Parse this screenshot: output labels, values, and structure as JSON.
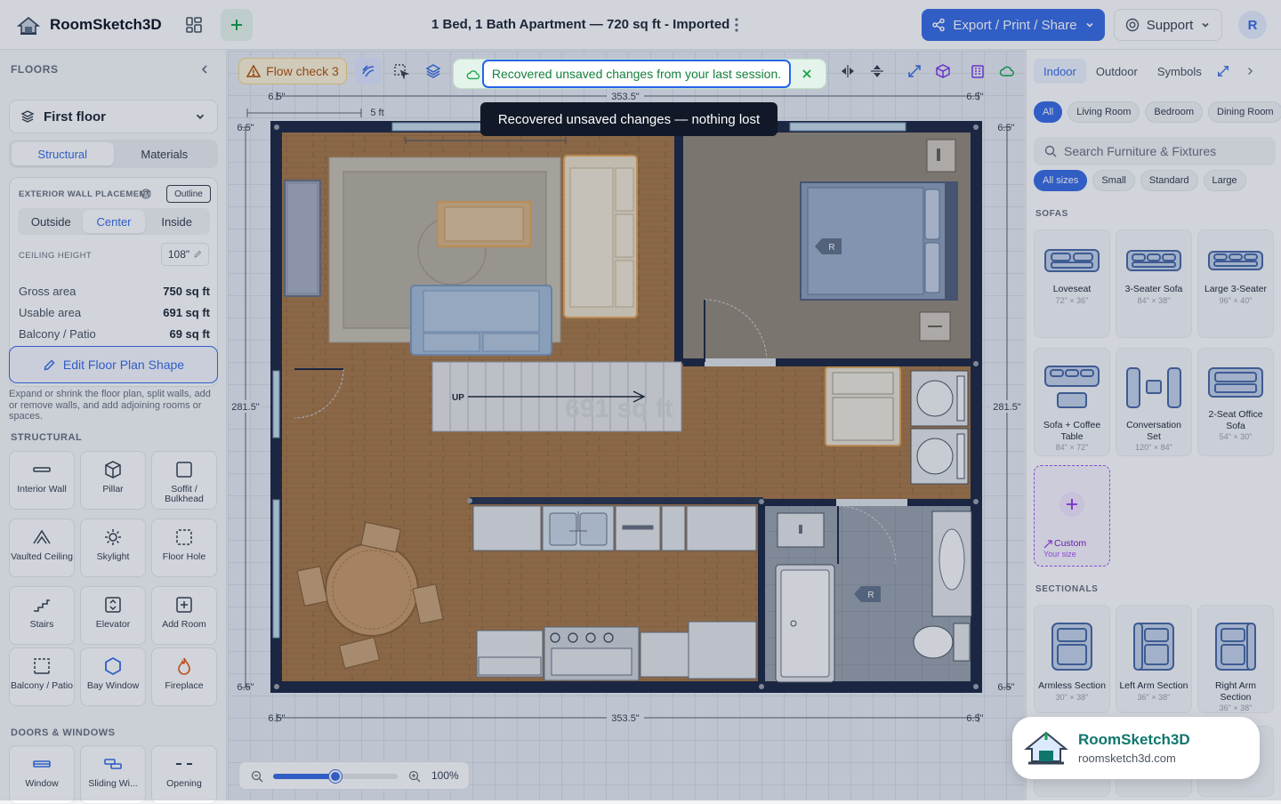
{
  "app": {
    "name": "RoomSketch3D"
  },
  "document": {
    "title": "1 Bed, 1 Bath Apartment — 720 sq ft - Imported"
  },
  "topbar": {
    "export_label": "Export / Print / Share",
    "support_label": "Support",
    "avatar_initial": "R"
  },
  "left": {
    "floors_header": "FLOORS",
    "floor_selected": "First floor",
    "tabs": [
      {
        "label": "Structural",
        "active": true
      },
      {
        "label": "Materials",
        "active": false
      }
    ],
    "wall_placement_label": "EXTERIOR WALL PLACEMENT",
    "outline_label": "Outline",
    "wall_options": [
      {
        "label": "Outside",
        "active": false
      },
      {
        "label": "Center",
        "active": true
      },
      {
        "label": "Inside",
        "active": false
      }
    ],
    "ceiling_label": "CEILING HEIGHT",
    "ceiling_value": "108\"",
    "stats": [
      {
        "label": "Gross area",
        "value": "750 sq ft"
      },
      {
        "label": "Usable area",
        "value": "691 sq ft"
      },
      {
        "label": "Balcony / Patio",
        "value": "69 sq ft"
      }
    ],
    "edit_shape_label": "Edit Floor Plan Shape",
    "edit_shape_desc": "Expand or shrink the floor plan, split walls, add or remove walls, and add adjoining rooms or spaces.",
    "structural_header": "STRUCTURAL",
    "tools": [
      {
        "label": "Interior Wall",
        "icon": "interior-wall-icon"
      },
      {
        "label": "Pillar",
        "icon": "pillar-icon"
      },
      {
        "label": "Soffit / Bulkhead",
        "icon": "soffit-icon"
      },
      {
        "label": "Vaulted Ceiling",
        "icon": "vaulted-ceiling-icon"
      },
      {
        "label": "Skylight",
        "icon": "skylight-icon"
      },
      {
        "label": "Floor Hole",
        "icon": "floor-hole-icon"
      },
      {
        "label": "Stairs",
        "icon": "stairs-icon"
      },
      {
        "label": "Elevator",
        "icon": "elevator-icon"
      },
      {
        "label": "Add Room",
        "icon": "add-room-icon"
      },
      {
        "label": "Balcony / Patio",
        "icon": "balcony-icon"
      },
      {
        "label": "Bay Window",
        "icon": "bay-window-icon"
      },
      {
        "label": "Fireplace",
        "icon": "fireplace-icon"
      }
    ],
    "doors_header": "DOORS & WINDOWS",
    "door_tools": [
      {
        "label": "Window",
        "icon": "window-icon"
      },
      {
        "label": "Sliding Wi...",
        "icon": "sliding-window-icon"
      },
      {
        "label": "Opening",
        "icon": "opening-icon"
      }
    ]
  },
  "canvas": {
    "flow_check_label": "Flow check 3",
    "scale_label": "5 ft",
    "dims": {
      "top": "353.5\"",
      "bottom": "353.5\"",
      "left": "281.5\"",
      "right": "281.5\"",
      "margin": "6.5\""
    },
    "stairs_label": "UP",
    "area_watermark": "691 sq ft",
    "room_tag": "R",
    "zoom": {
      "value_label": "100%",
      "level": 0.5
    }
  },
  "right": {
    "tabs": [
      {
        "label": "Indoor",
        "active": true
      },
      {
        "label": "Outdoor",
        "active": false
      },
      {
        "label": "Symbols",
        "active": false
      }
    ],
    "room_filters": [
      {
        "label": "All",
        "active": true
      },
      {
        "label": "Living Room",
        "active": false
      },
      {
        "label": "Bedroom",
        "active": false
      },
      {
        "label": "Dining Room",
        "active": false
      }
    ],
    "search_placeholder": "Search Furniture & Fixtures",
    "size_filters": [
      {
        "label": "All sizes",
        "active": true
      },
      {
        "label": "Small",
        "active": false
      },
      {
        "label": "Standard",
        "active": false
      },
      {
        "label": "Large",
        "active": false
      }
    ],
    "sofas_header": "SOFAS",
    "sofas": [
      {
        "name": "Loveseat",
        "dims": "72\" × 36\""
      },
      {
        "name": "3-Seater Sofa",
        "dims": "84\" × 38\""
      },
      {
        "name": "Large 3-Seater",
        "dims": "96\" × 40\""
      },
      {
        "name": "Sofa + Coffee Table",
        "dims": "84\" × 72\""
      },
      {
        "name": "Conversation Set",
        "dims": "120\" × 84\""
      },
      {
        "name": "2-Seat Office Sofa",
        "dims": "54\" × 30\""
      }
    ],
    "custom": {
      "label": "Custom",
      "sub": "Your size"
    },
    "sectionals_header": "SECTIONALS",
    "sectionals": [
      {
        "name": "Armless Section",
        "dims": "30\" × 38\""
      },
      {
        "name": "Left Arm Section",
        "dims": "36\" × 38\""
      },
      {
        "name": "Right Arm Section",
        "dims": "36\" × 38\""
      }
    ]
  },
  "overlay": {
    "toast_message": "Recovered unsaved changes from your last session.",
    "tooltip": "Recovered unsaved changes — nothing lost",
    "brand_name": "RoomSketch3D",
    "brand_url": "roomsketch3d.com"
  },
  "colors": {
    "accent": "#3b6ee6",
    "success": "#16a34a",
    "warning": "#b45309",
    "wall": "#1f2a44",
    "floor_wood": "#a87a4a"
  }
}
